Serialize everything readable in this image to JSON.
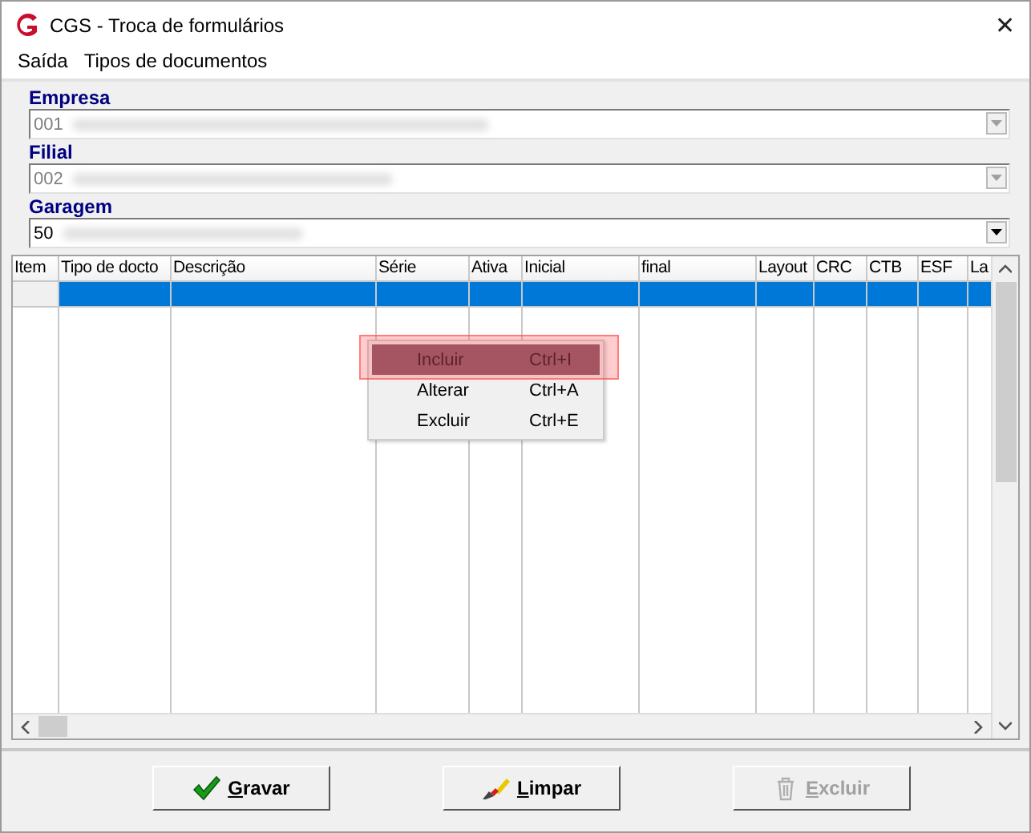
{
  "window": {
    "title": "CGS - Troca de formulários",
    "close": "✕"
  },
  "menu": [
    "Saída",
    "Tipos de documentos"
  ],
  "fields": [
    {
      "label": "Empresa",
      "value": "001",
      "disabled": true
    },
    {
      "label": "Filial",
      "value": "002",
      "disabled": true
    },
    {
      "label": "Garagem",
      "value": "50",
      "disabled": false
    }
  ],
  "table": {
    "columns": [
      "Item",
      "Tipo de docto",
      "Descrição",
      "Série",
      "Ativa",
      "Inicial",
      "final",
      "Layout",
      "CRC",
      "CTB",
      "ESF",
      "La"
    ],
    "rows": [
      {
        "selected": true
      }
    ]
  },
  "context_menu": [
    {
      "label": "Incluir",
      "shortcut": "Ctrl+I",
      "highlighted": true
    },
    {
      "label": "Alterar",
      "shortcut": "Ctrl+A",
      "highlighted": false
    },
    {
      "label": "Excluir",
      "shortcut": "Ctrl+E",
      "highlighted": false
    }
  ],
  "buttons": [
    {
      "label": "Gravar",
      "kind": "save",
      "disabled": false
    },
    {
      "label": "Limpar",
      "kind": "clear",
      "disabled": false
    },
    {
      "label": "Excluir",
      "kind": "delete",
      "disabled": true
    }
  ]
}
